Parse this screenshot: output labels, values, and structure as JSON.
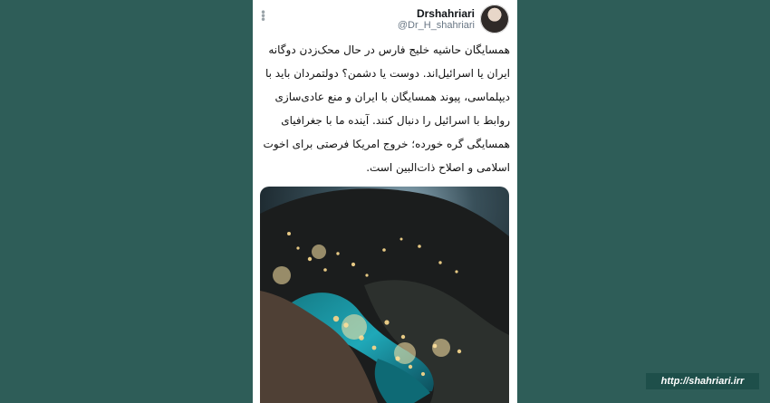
{
  "profile": {
    "name": "Drshahriari",
    "handle": "@Dr_H_shahriari"
  },
  "tweet": {
    "lines": [
      "همسایگان حاشیه خلیج فارس در حال محک‌زدن دوگانه",
      "ایران یا اسرائیل‌اند. دوست یا دشمن؟ دولتمردان باید با",
      "دیپلماسی، پیوند همسایگان با ایران و منع عادی‌سازی",
      "روابط با اسرائیل را دنبال کنند. آینده ما با جغرافیای",
      "همسایگی گره خورده؛ خروج امریکا فرصتی برای اخوت",
      "اسلامی و اصلاح ذات‌البین است."
    ]
  },
  "watermark": {
    "url": "http://shahriari.irr"
  },
  "colors": {
    "background": "#2e5d58",
    "card": "#ffffff",
    "sea": "#1fa8b8"
  },
  "icons": {
    "menu": "more-vertical-icon",
    "avatar": "user-avatar"
  }
}
